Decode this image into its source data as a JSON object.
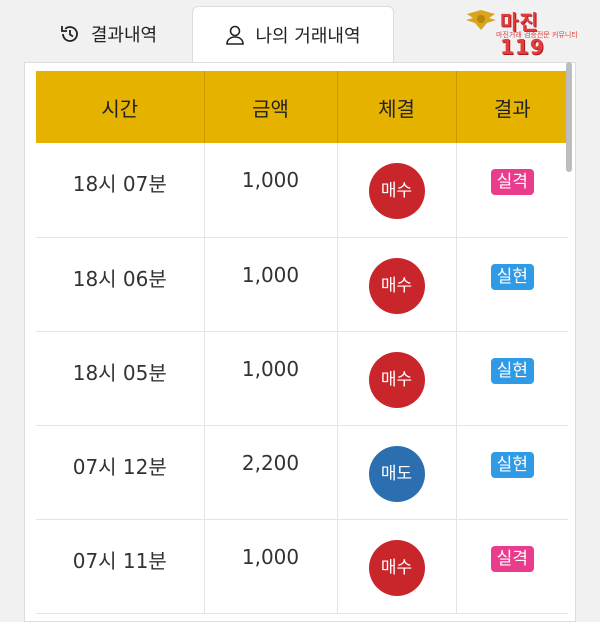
{
  "tabs": [
    {
      "label": "결과내역",
      "icon": "history-icon"
    },
    {
      "label": "나의 거래내역",
      "icon": "user-icon"
    }
  ],
  "logo": {
    "text": "마진",
    "suffix": "119",
    "subtitle": "마진거래 검증전문 커뮤니티"
  },
  "table": {
    "headers": [
      "시간",
      "금액",
      "체결",
      "결과"
    ],
    "rows": [
      {
        "time": "18시 07분",
        "amount": "1,000",
        "trade": "매수",
        "result": "실격"
      },
      {
        "time": "18시 06분",
        "amount": "1,000",
        "trade": "매수",
        "result": "실현"
      },
      {
        "time": "18시 05분",
        "amount": "1,000",
        "trade": "매수",
        "result": "실현"
      },
      {
        "time": "07시 12분",
        "amount": "2,200",
        "trade": "매도",
        "result": "실현"
      },
      {
        "time": "07시 11분",
        "amount": "1,000",
        "trade": "매수",
        "result": "실격"
      }
    ]
  },
  "colors": {
    "header": "#e6b200",
    "buy": "#c9262c",
    "sell": "#2c6fb0",
    "fail": "#ea3b8c",
    "win": "#2f9ae6"
  }
}
